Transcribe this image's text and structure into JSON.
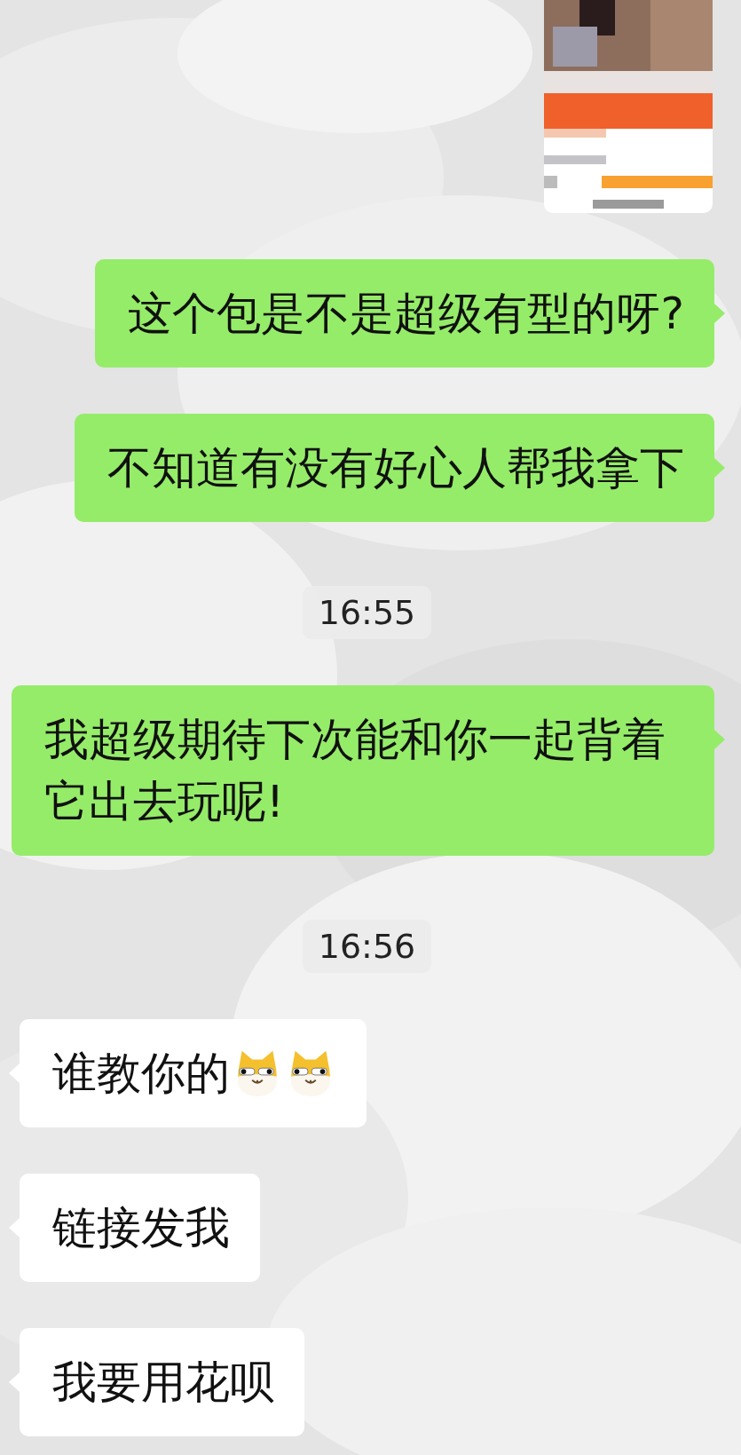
{
  "messages": [
    {
      "kind": "picture",
      "outgoing": true
    },
    {
      "kind": "text",
      "outgoing": true,
      "text": "这个包是不是超级有型的呀?"
    },
    {
      "kind": "text",
      "outgoing": true,
      "text": "不知道有没有好心人帮我拿下"
    },
    {
      "kind": "time",
      "text": "16:55"
    },
    {
      "kind": "text",
      "outgoing": true,
      "text": "我超级期待下次能和你一起背着它出去玩呢!"
    },
    {
      "kind": "time",
      "text": "16:56"
    },
    {
      "kind": "text",
      "outgoing": false,
      "text": "谁教你的",
      "stickers": [
        {
          "kind": "doge"
        },
        {
          "kind": "doge"
        }
      ]
    },
    {
      "kind": "text",
      "outgoing": false,
      "text": "链接发我"
    },
    {
      "kind": "text",
      "outgoing": false,
      "text": "我要用花呗"
    }
  ]
}
